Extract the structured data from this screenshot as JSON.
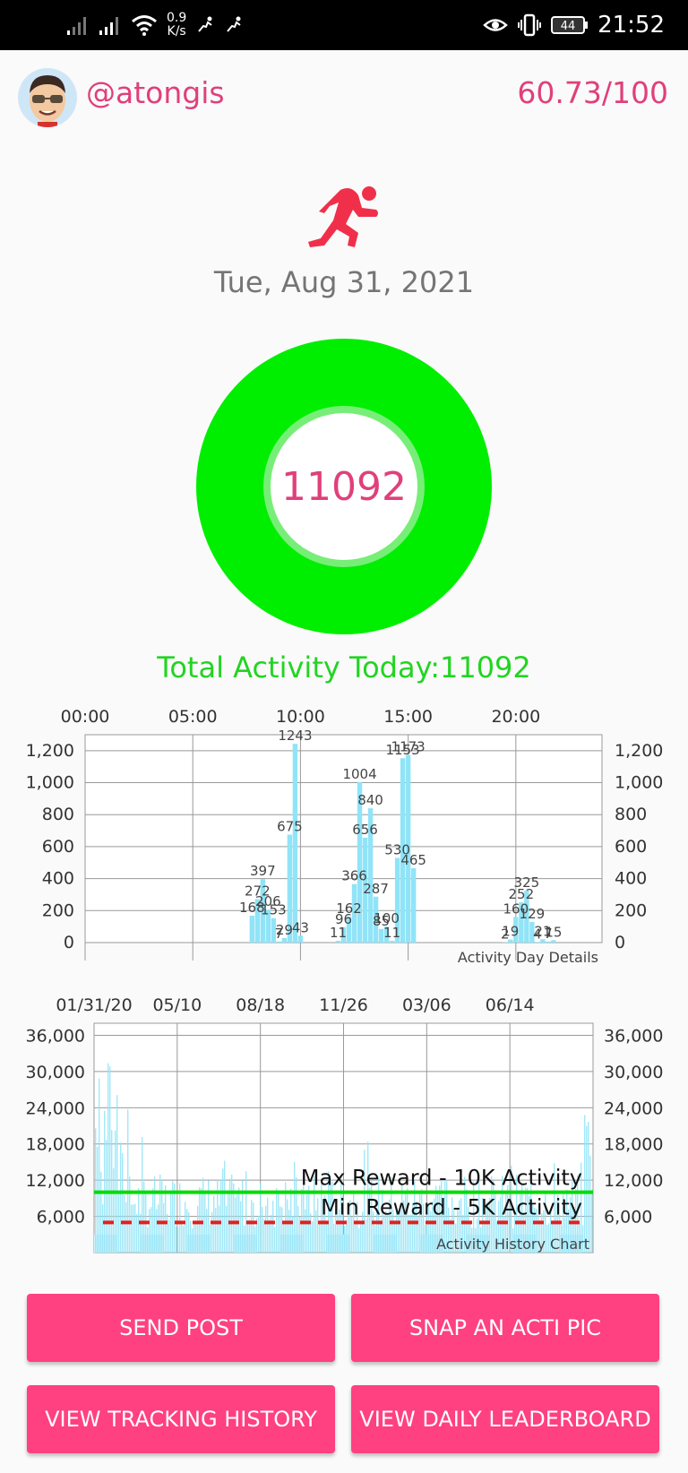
{
  "status_bar": {
    "speed_value": "0.9",
    "speed_unit": "K/s",
    "battery": "44",
    "time": "21:52"
  },
  "user": {
    "handle": "@atongis",
    "score": "60.73/100"
  },
  "date": "Tue, Aug 31, 2021",
  "activity_today": "11092",
  "total_label": "Total Activity Today:11092",
  "colors": {
    "accent": "#e0407a",
    "button": "#ff4081",
    "ring": "#00ee00",
    "total_text": "#22d422",
    "bars": "#90e4f7",
    "max_line": "#00dd00",
    "min_line": "#e02020"
  },
  "icons": {
    "runner": "runner-icon",
    "avatar": "avatar-icon"
  },
  "chart_data": [
    {
      "type": "bar",
      "title": "Activity Day Details",
      "x_tick_labels": [
        "00:00",
        "05:00",
        "10:00",
        "15:00",
        "20:00"
      ],
      "x_unit": "hours",
      "xlim": [
        0,
        24
      ],
      "ylim": [
        0,
        1300
      ],
      "y_ticks": [
        0,
        200,
        400,
        600,
        800,
        1000,
        1200
      ],
      "y_tick_labels": [
        "0",
        "200",
        "400",
        "600",
        "800",
        "1,000",
        "1,200"
      ],
      "x": [
        7.75,
        8.0,
        8.25,
        8.5,
        8.75,
        9.0,
        9.25,
        9.5,
        9.75,
        10.0,
        11.75,
        12.0,
        12.25,
        12.5,
        12.75,
        13.0,
        13.25,
        13.5,
        13.75,
        14.0,
        14.25,
        14.5,
        14.75,
        15.0,
        15.25,
        19.5,
        19.75,
        20.0,
        20.25,
        20.5,
        20.75,
        21.0,
        21.25,
        21.5,
        21.75
      ],
      "values": [
        168,
        272,
        397,
        206,
        153,
        7,
        29,
        675,
        1243,
        43,
        11,
        96,
        162,
        366,
        1004,
        656,
        840,
        287,
        85,
        100,
        11,
        530,
        1153,
        1173,
        465,
        2,
        19,
        160,
        252,
        325,
        129,
        4,
        21,
        7,
        15
      ],
      "grid": true
    },
    {
      "type": "bar",
      "title": "Activity History Chart",
      "x_tick_labels": [
        "01/31/20",
        "05/10",
        "08/18",
        "11/26",
        "03/06",
        "06/14"
      ],
      "ylim": [
        0,
        38000
      ],
      "y_ticks": [
        6000,
        12000,
        18000,
        24000,
        30000,
        36000
      ],
      "y_tick_labels": [
        "6,000",
        "12,000",
        "18,000",
        "24,000",
        "30,000",
        "36,000"
      ],
      "lines": [
        {
          "name": "Max Reward - 10K Activity",
          "value": 10000,
          "style": "solid"
        },
        {
          "name": "Min Reward - 5K Activity",
          "value": 5000,
          "style": "dashed"
        }
      ],
      "grid": true
    }
  ],
  "buttons": {
    "send_post": "SEND POST",
    "snap_pic": "SNAP AN ACTI PIC",
    "tracking_history": "VIEW TRACKING HISTORY",
    "daily_leaderboard": "VIEW DAILY LEADERBOARD"
  }
}
